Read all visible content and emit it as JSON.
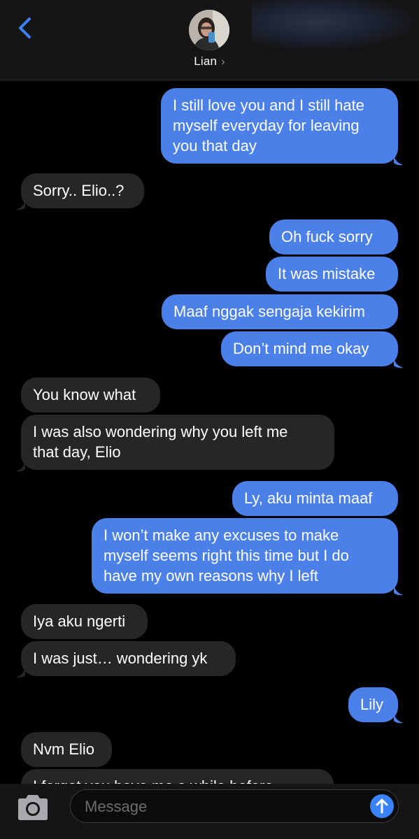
{
  "header": {
    "contact_name": "Lian",
    "chevron": "›"
  },
  "messages": [
    {
      "from": "me",
      "text": "I still love you and I still hate\nmyself everyday for leaving\nyou that day"
    },
    {
      "from": "them",
      "text": "Sorry.. Elio..?"
    },
    {
      "from": "me",
      "text": "Oh fuck sorry"
    },
    {
      "from": "me",
      "text": "It was mistake"
    },
    {
      "from": "me",
      "text": "Maaf nggak sengaja kekirim"
    },
    {
      "from": "me",
      "text": "Don’t mind me okay"
    },
    {
      "from": "them",
      "text": "You know what"
    },
    {
      "from": "them",
      "text": "I was also wondering why you left me\nthat day, Elio"
    },
    {
      "from": "me",
      "text": "Ly, aku minta maaf"
    },
    {
      "from": "me",
      "text": "I won’t make any excuses to make\nmyself seems right this time but I do\nhave my own reasons why I left"
    },
    {
      "from": "them",
      "text": "Iya aku ngerti"
    },
    {
      "from": "them",
      "text": "I was just… wondering yk"
    },
    {
      "from": "me",
      "text": "Lily"
    },
    {
      "from": "them",
      "text": "Nvm Elio"
    },
    {
      "from": "them",
      "text": "I forgot you have me a while before"
    }
  ],
  "compose": {
    "placeholder": "Message"
  },
  "colors": {
    "sent_bubble": "#4a80e8",
    "received_bubble": "#262628",
    "accent": "#3a82f7",
    "background": "#000000"
  },
  "icons": [
    "back-chevron-icon",
    "camera-icon",
    "send-arrow-icon"
  ]
}
